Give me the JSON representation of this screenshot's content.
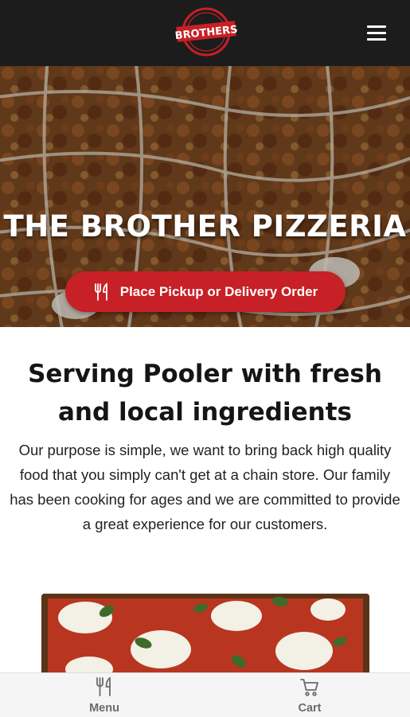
{
  "header": {
    "logo_text": "BROTHERS",
    "logo_icon": "brothers-pizzeria-logo",
    "menu_icon": "hamburger-menu-icon"
  },
  "hero": {
    "title": "THE BROTHER PIZZERIA",
    "order_button_label": "Place Pickup or Delivery Order",
    "order_button_icon": "fork-knife-icon"
  },
  "about": {
    "headline": "Serving Pooler with fresh and local ingredients",
    "body": "Our purpose is simple, we want to bring back high quality food that you simply can't get at a chain store. Our family has been cooking for ages and we are committed to provide a great experience for our customers."
  },
  "bottom_nav": {
    "items": [
      {
        "label": "Menu",
        "icon": "fork-knife-icon"
      },
      {
        "label": "Cart",
        "icon": "cart-icon"
      }
    ]
  },
  "colors": {
    "topbar": "#1c1c1c",
    "accent": "#c72026",
    "text": "#151515"
  }
}
